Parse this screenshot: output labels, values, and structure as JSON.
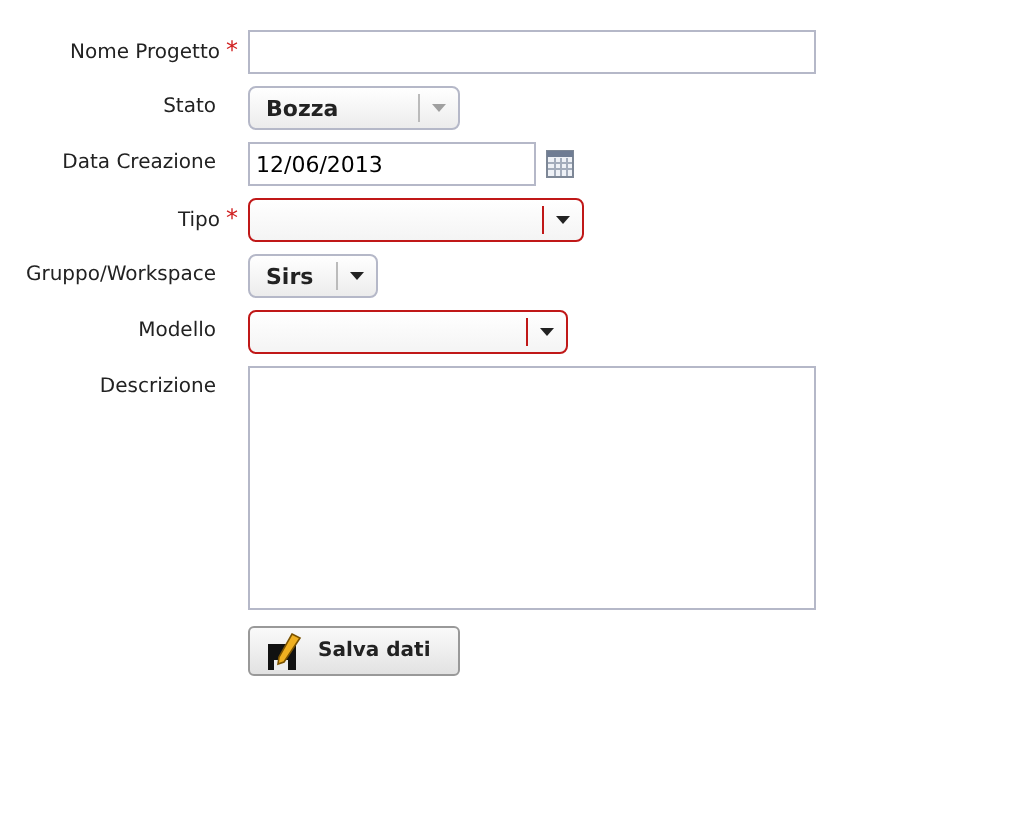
{
  "form": {
    "fields": [
      {
        "label": "Nome Progetto",
        "required": true,
        "kind": "text"
      },
      {
        "label": "Stato",
        "required": false,
        "kind": "select",
        "value": "Bozza",
        "invalid": false,
        "disabled": true
      },
      {
        "label": "Data Creazione",
        "required": false,
        "kind": "date",
        "value": "12/06/2013"
      },
      {
        "label": "Tipo",
        "required": true,
        "kind": "select",
        "invalid": true,
        "disabled": false
      },
      {
        "label": "Gruppo/Workspace",
        "required": false,
        "kind": "select",
        "value": "Sirs",
        "invalid": false,
        "disabled": false
      },
      {
        "label": "Modello",
        "required": false,
        "kind": "select",
        "invalid": true,
        "disabled": false
      },
      {
        "label": "Descrizione",
        "required": false,
        "kind": "textarea"
      }
    ],
    "required_mark": "*",
    "save_button": "Salva dati"
  }
}
